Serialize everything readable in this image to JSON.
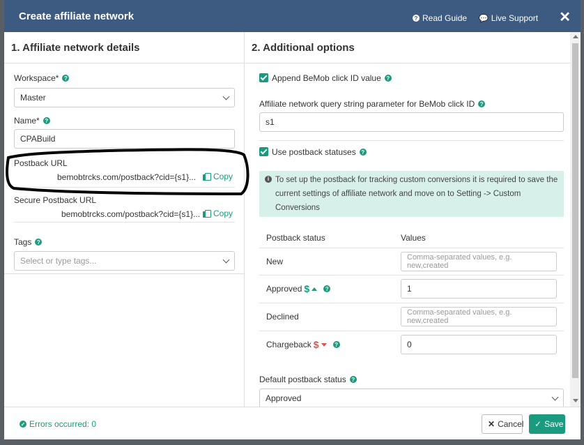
{
  "header": {
    "title": "Create affiliate network",
    "read_guide": "Read Guide",
    "live_support": "Live Support",
    "close": "✕"
  },
  "left": {
    "section_title": "1. Affiliate network details",
    "workspace_label": "Workspace*",
    "workspace_value": "Master",
    "name_label": "Name*",
    "name_value": "CPABuild",
    "postback_label": "Postback URL",
    "postback_url": "bemobtrcks.com/postback?cid={s1}...",
    "secure_postback_label": "Secure Postback URL",
    "secure_postback_url": "bemobtrcks.com/postback?cid={s1}...",
    "copy_label": "Copy",
    "tags_label": "Tags",
    "tags_placeholder": "Select or type tags..."
  },
  "right": {
    "section_title": "2. Additional options",
    "append_label": "Append BeMob click ID value",
    "query_label": "Affiliate network query string parameter for BeMob click ID",
    "query_value": "s1",
    "use_statuses_label": "Use postback statuses",
    "info_text": "To set up the postback for tracking custom conversions it is required to save the current settings of affiliate network and move on to Setting -> Custom Conversions",
    "table": {
      "col_status": "Postback status",
      "col_values": "Values",
      "rows": [
        {
          "status": "New",
          "value": "",
          "placeholder": "Comma-separated values, e.g. new,created"
        },
        {
          "status": "Approved",
          "value": "1",
          "placeholder": ""
        },
        {
          "status": "Declined",
          "value": "",
          "placeholder": "Comma-separated values, e.g. new,created"
        },
        {
          "status": "Chargeback",
          "value": "0",
          "placeholder": ""
        }
      ]
    },
    "default_status_label": "Default postback status",
    "default_status_value": "Approved"
  },
  "footer": {
    "errors_text": "Errors occurred: 0",
    "cancel_label": "Cancel",
    "save_label": "Save"
  },
  "colors": {
    "header_bg": "#3d5a80",
    "accent": "#1a9a7e",
    "info_bg": "#d8f0ea",
    "danger": "#d9534f"
  }
}
